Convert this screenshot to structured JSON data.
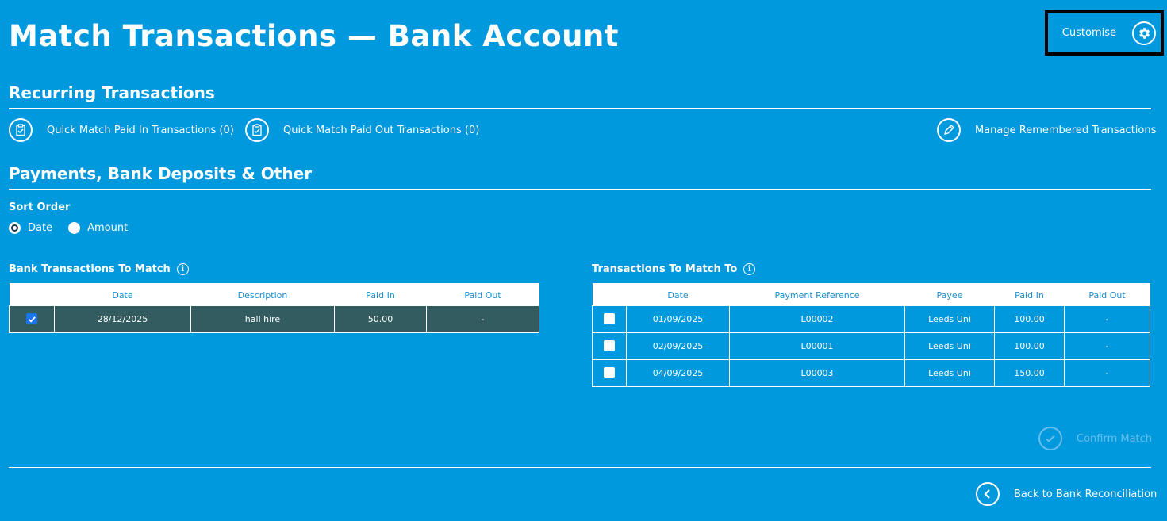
{
  "header": {
    "title": "Match Transactions — Bank Account",
    "customise_label": "Customise"
  },
  "recurring": {
    "title": "Recurring Transactions",
    "quick_in": "Quick Match Paid In Transactions (0)",
    "quick_out": "Quick Match Paid Out Transactions (0)",
    "manage": "Manage Remembered Transactions"
  },
  "payments": {
    "title": "Payments, Bank Deposits & Other"
  },
  "sort": {
    "title": "Sort Order",
    "options": [
      "Date",
      "Amount"
    ],
    "selected": "Date"
  },
  "bank_table": {
    "title": "Bank Transactions To Match",
    "headers": [
      "",
      "Date",
      "Description",
      "Paid In",
      "Paid Out"
    ],
    "rows": [
      {
        "checked": true,
        "date": "28/12/2025",
        "description": "hall hire",
        "paid_in": "50.00",
        "paid_out": "-"
      }
    ]
  },
  "match_table": {
    "title": "Transactions To Match To",
    "headers": [
      "",
      "Date",
      "Payment Reference",
      "Payee",
      "Paid In",
      "Paid Out"
    ],
    "rows": [
      {
        "checked": false,
        "date": "01/09/2025",
        "reference": "L00002",
        "payee": "Leeds Uni",
        "paid_in": "100.00",
        "paid_out": "-"
      },
      {
        "checked": false,
        "date": "02/09/2025",
        "reference": "L00001",
        "payee": "Leeds Uni",
        "paid_in": "100.00",
        "paid_out": "-"
      },
      {
        "checked": false,
        "date": "04/09/2025",
        "reference": "L00003",
        "payee": "Leeds Uni",
        "paid_in": "150.00",
        "paid_out": "-"
      }
    ]
  },
  "actions": {
    "confirm_label": "Confirm Match",
    "back_label": "Back to Bank Reconciliation"
  },
  "colors": {
    "background": "#0099dd",
    "selected_row": "#335c60",
    "header_text": "#1a8fd0"
  }
}
